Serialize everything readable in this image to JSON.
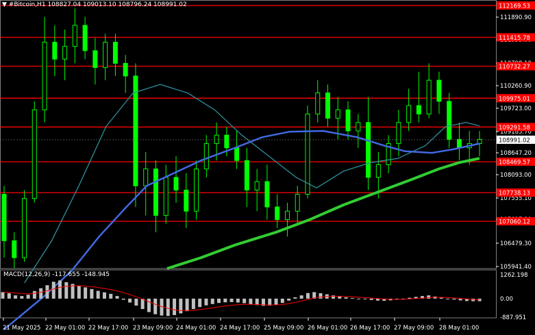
{
  "header": {
    "symbol": "#Bitcoin,H1",
    "ohlc": "108827.04 109013.10 108796.24 108991.02"
  },
  "macd": {
    "label": "MACD(12,26,9) -117.655 -148.945",
    "scale_labels": [
      "1262.198",
      "0.00",
      "-887.951"
    ]
  },
  "price_axis": {
    "ticks": [
      "111890.90",
      "111333.00",
      "110798.10",
      "110260.90",
      "109723.00",
      "109185.70",
      "108647.20",
      "108093.00",
      "107555.10",
      "107017.20",
      "106479.30",
      "105941.40"
    ],
    "current_price": "108991.02"
  },
  "levels": [
    {
      "label": "112169.53",
      "value": 112169.53
    },
    {
      "label": "111415.78",
      "value": 111415.78
    },
    {
      "label": "110732.27",
      "value": 110732.27
    },
    {
      "label": "109975.01",
      "value": 109975.01
    },
    {
      "label": "109291.58",
      "value": 109291.58
    },
    {
      "label": "108469.57",
      "value": 108469.57
    },
    {
      "label": "107738.13",
      "value": 107738.13
    },
    {
      "label": "107060.12",
      "value": 107060.12
    }
  ],
  "time_axis": [
    "21 May 2025",
    "22 May 01:00",
    "22 May 17:00",
    "23 May 09:00",
    "24 May 01:00",
    "24 May 17:00",
    "25 May 09:00",
    "26 May 01:00",
    "26 May 17:00",
    "27 May 09:00",
    "28 May 01:00"
  ],
  "colors": {
    "background": "#000000",
    "candle_up": "#00ff00",
    "candle_down": "#00ff00",
    "level_line": "#ff0000",
    "ma_fast": "#4169e1",
    "ma_mid": "#2f8f9d",
    "ma_slow": "#32cd32",
    "macd_hist": "#c0c0c0",
    "macd_signal": "#ff0000"
  },
  "chart_data": {
    "type": "candlestick",
    "y_range": [
      105941.4,
      112169.53
    ],
    "ma_fast": [
      [
        0,
        104500
      ],
      [
        6,
        105300
      ],
      [
        10,
        105900
      ],
      [
        14,
        106700
      ],
      [
        18,
        107400
      ],
      [
        21,
        107900
      ],
      [
        25,
        108200
      ],
      [
        29,
        108500
      ],
      [
        34,
        108800
      ],
      [
        38,
        109050
      ],
      [
        42,
        109180
      ],
      [
        47,
        109200
      ],
      [
        52,
        109050
      ],
      [
        56,
        108850
      ],
      [
        59,
        108720
      ],
      [
        63,
        108680
      ],
      [
        66,
        108760
      ],
      [
        68,
        108830
      ],
      [
        70,
        108900
      ]
    ],
    "ma_mid": [
      [
        3,
        105600
      ],
      [
        7,
        106600
      ],
      [
        11,
        107900
      ],
      [
        15,
        109300
      ],
      [
        19,
        110100
      ],
      [
        23,
        110300
      ],
      [
        27,
        110100
      ],
      [
        31,
        109700
      ],
      [
        35,
        109100
      ],
      [
        39,
        108600
      ],
      [
        43,
        108100
      ],
      [
        46,
        107850
      ],
      [
        50,
        108250
      ],
      [
        54,
        108450
      ],
      [
        58,
        108550
      ],
      [
        62,
        108850
      ],
      [
        65,
        109300
      ],
      [
        68,
        109400
      ],
      [
        70,
        109320
      ]
    ],
    "ma_slow": [
      [
        24,
        105941
      ],
      [
        29,
        106200
      ],
      [
        34,
        106500
      ],
      [
        40,
        106800
      ],
      [
        45,
        107100
      ],
      [
        50,
        107450
      ],
      [
        55,
        107750
      ],
      [
        60,
        108050
      ],
      [
        64,
        108300
      ],
      [
        67,
        108450
      ],
      [
        70,
        108550
      ]
    ],
    "candles": [
      [
        107700,
        107900,
        106200,
        106600
      ],
      [
        106600,
        106800,
        105950,
        106200
      ],
      [
        106200,
        107800,
        106100,
        107600
      ],
      [
        107600,
        109900,
        107500,
        109700
      ],
      [
        109700,
        111900,
        109400,
        111300
      ],
      [
        111300,
        111700,
        110500,
        110900
      ],
      [
        110900,
        111600,
        110400,
        111200
      ],
      [
        111200,
        112100,
        110800,
        111700
      ],
      [
        111700,
        111900,
        110900,
        111100
      ],
      [
        111100,
        111400,
        110300,
        110700
      ],
      [
        110700,
        111500,
        110400,
        111300
      ],
      [
        111300,
        111500,
        110500,
        110800
      ],
      [
        110800,
        111000,
        110100,
        110500
      ],
      [
        110500,
        110800,
        107400,
        107900
      ],
      [
        107900,
        108700,
        107200,
        108300
      ],
      [
        108300,
        108500,
        106800,
        107200
      ],
      [
        107200,
        108400,
        107000,
        108100
      ],
      [
        108100,
        108600,
        107500,
        107800
      ],
      [
        107800,
        108200,
        106900,
        107300
      ],
      [
        107300,
        108500,
        107100,
        108300
      ],
      [
        108300,
        109100,
        108100,
        108900
      ],
      [
        108900,
        109400,
        108500,
        109100
      ],
      [
        109100,
        109300,
        108600,
        108800
      ],
      [
        108800,
        109200,
        108300,
        108500
      ],
      [
        108500,
        108800,
        107400,
        107800
      ],
      [
        107800,
        108300,
        107300,
        108000
      ],
      [
        108000,
        108400,
        107100,
        107400
      ],
      [
        107400,
        107700,
        106900,
        107100
      ],
      [
        107100,
        107500,
        106700,
        107300
      ],
      [
        107300,
        107900,
        107000,
        107700
      ],
      [
        107700,
        109800,
        107600,
        109600
      ],
      [
        109600,
        110400,
        109400,
        110100
      ],
      [
        110100,
        110300,
        109300,
        109500
      ],
      [
        109500,
        110000,
        109000,
        109700
      ],
      [
        109700,
        109900,
        109000,
        109200
      ],
      [
        109200,
        109600,
        108800,
        109400
      ],
      [
        109400,
        110000,
        107800,
        108100
      ],
      [
        108100,
        108700,
        107600,
        108400
      ],
      [
        108400,
        109100,
        108200,
        108900
      ],
      [
        108900,
        109700,
        108600,
        109400
      ],
      [
        109400,
        110200,
        109200,
        109800
      ],
      [
        109800,
        110600,
        109400,
        109600
      ],
      [
        109600,
        110800,
        109500,
        110400
      ],
      [
        110400,
        110600,
        109600,
        109900
      ],
      [
        109900,
        110100,
        108800,
        109000
      ],
      [
        109000,
        109400,
        108500,
        108800
      ],
      [
        108800,
        109200,
        108400,
        108900
      ],
      [
        108900,
        109200,
        108600,
        109000
      ]
    ],
    "macd_hist": [
      300,
      250,
      150,
      120,
      180,
      350,
      480,
      620,
      780,
      840,
      760,
      680,
      600,
      520,
      440,
      360,
      290,
      220,
      120,
      -50,
      -180,
      -320,
      -480,
      -620,
      -720,
      -780,
      -800,
      -760,
      -680,
      -580,
      -480,
      -390,
      -310,
      -250,
      -200,
      -170,
      -160,
      -180,
      -210,
      -260,
      -300,
      -330,
      -320,
      -280,
      -200,
      -90,
      60,
      150,
      260,
      300,
      250,
      200,
      150,
      100,
      60,
      30,
      -10,
      -30,
      -60,
      -90,
      -100,
      -80,
      -50,
      -10,
      40,
      80,
      120,
      150,
      100,
      50,
      0,
      -40,
      -80,
      -110,
      -120,
      -118
    ]
  }
}
